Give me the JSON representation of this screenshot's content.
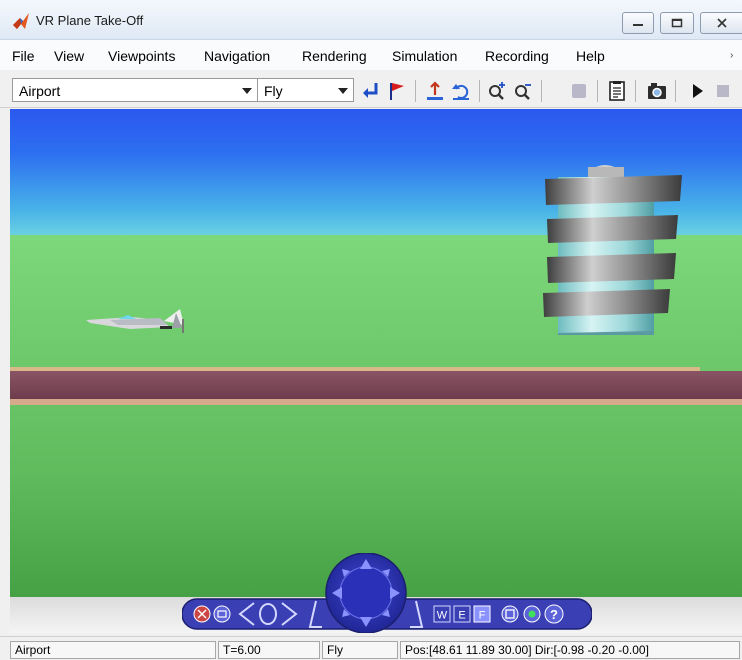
{
  "window": {
    "title": "VR Plane Take-Off"
  },
  "menu": [
    "File",
    "View",
    "Viewpoints",
    "Navigation",
    "Rendering",
    "Simulation",
    "Recording",
    "Help"
  ],
  "toolbar": {
    "viewpoint": "Airport",
    "navigation_mode": "Fly",
    "icons": [
      "return-icon",
      "flag-icon",
      "goto-start-icon",
      "undo-move-icon",
      "zoom-in-icon",
      "zoom-out-icon",
      "record-icon",
      "notes-icon",
      "camera-icon",
      "play-icon",
      "stop-icon"
    ]
  },
  "nav_panel": {
    "buttons": {
      "walk": "W",
      "examine": "E",
      "fly": "F",
      "help": "?"
    }
  },
  "status": {
    "viewpoint": "Airport",
    "time": "T=6.00",
    "mode": "Fly",
    "position": "Pos:[48.61 11.89 30.00] Dir:[-0.98 -0.20 -0.00]"
  },
  "colors": {
    "sky_top": "#2b58ef",
    "sky_bottom": "#6ad0e2",
    "grass": "#6dc96a",
    "runway": "#7a4757",
    "nav_panel": "#3a3fb4"
  }
}
